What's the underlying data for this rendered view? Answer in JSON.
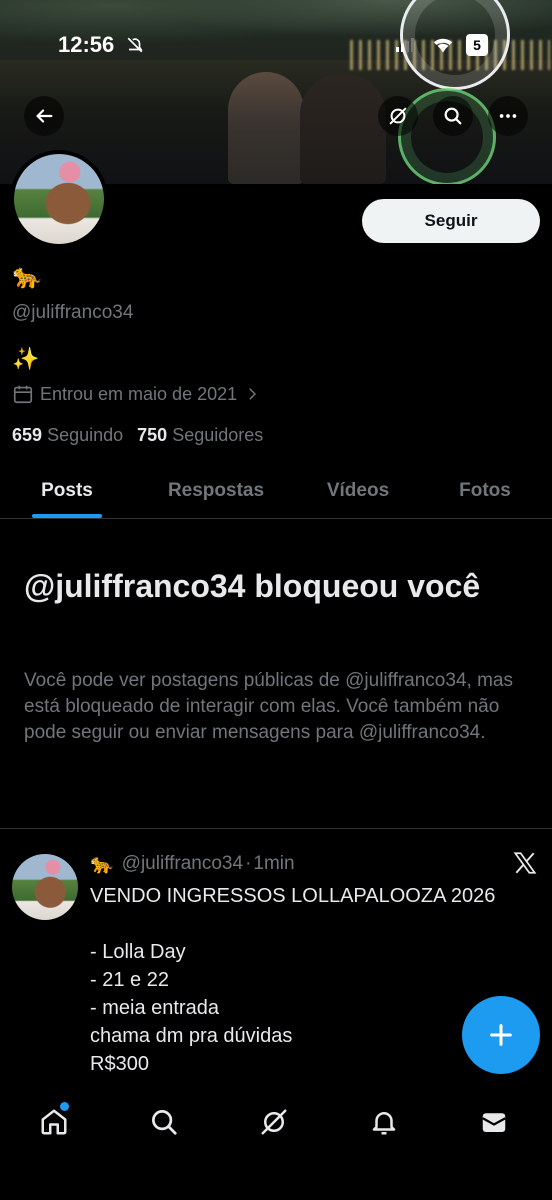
{
  "status_bar": {
    "time": "12:56",
    "battery": "5"
  },
  "profile": {
    "display_name": "🐆",
    "handle": "@juliffranco34",
    "bio": "✨",
    "joined": "Entrou em maio de 2021",
    "following_count": "659",
    "following_label": "Seguindo",
    "followers_count": "750",
    "followers_label": "Seguidores",
    "follow_button": "Seguir"
  },
  "tabs": [
    {
      "label": "Posts",
      "active": true
    },
    {
      "label": "Respostas",
      "active": false
    },
    {
      "label": "Vídeos",
      "active": false
    },
    {
      "label": "Fotos",
      "active": false
    }
  ],
  "blocked": {
    "title": "@juliffranco34 bloqueou você",
    "description": "Você pode ver postagens públicas de @juliffranco34, mas está bloqueado de interagir com elas. Você também não pode seguir ou enviar mensagens para @juliffranco34."
  },
  "post": {
    "author_emoji": "🐆",
    "author_handle": "@juliffranco34",
    "separator": "·",
    "time": "1min",
    "lines": [
      "VENDO INGRESSOS LOLLAPALOOZA 2026",
      "",
      "- Lolla Day",
      "- 21 e 22",
      "- meia entrada",
      "chama dm pra dúvidas",
      "R$300"
    ]
  },
  "colors": {
    "accent": "#1d9bf0",
    "muted": "#71767b",
    "text": "#e7e9ea",
    "background": "#000000"
  }
}
